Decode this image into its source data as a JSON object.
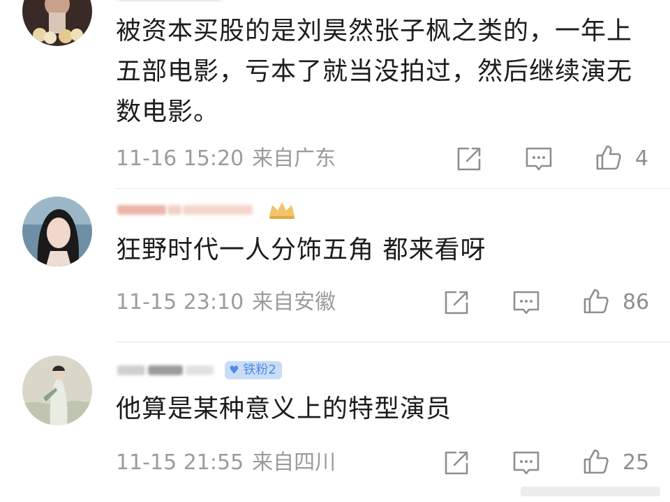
{
  "comments": [
    {
      "username": "",
      "text": "被资本买股的是刘昊然张子枫之类的，一年上五部电影，亏本了就当没拍过，然后继续演无数电影。",
      "time": "11-16 15:20",
      "location": "来自广东",
      "likes": "4"
    },
    {
      "username": "",
      "text": "狂野时代一人分饰五角 都来看呀",
      "time": "11-15 23:10",
      "location": "来自安徽",
      "likes": "86"
    },
    {
      "username": "",
      "badge": "铁粉2",
      "text": "他算是某种意义上的特型演员",
      "time": "11-15 21:55",
      "location": "来自四川",
      "likes": "25"
    }
  ],
  "icons": {
    "share": "share-icon",
    "reply": "comment-icon",
    "like": "thumbs-up-icon"
  },
  "colors": {
    "meta": "#9b9b9b",
    "icon": "#8e8e8e",
    "badge_bg": "#c9dcf6",
    "badge_text": "#4f8be6"
  }
}
